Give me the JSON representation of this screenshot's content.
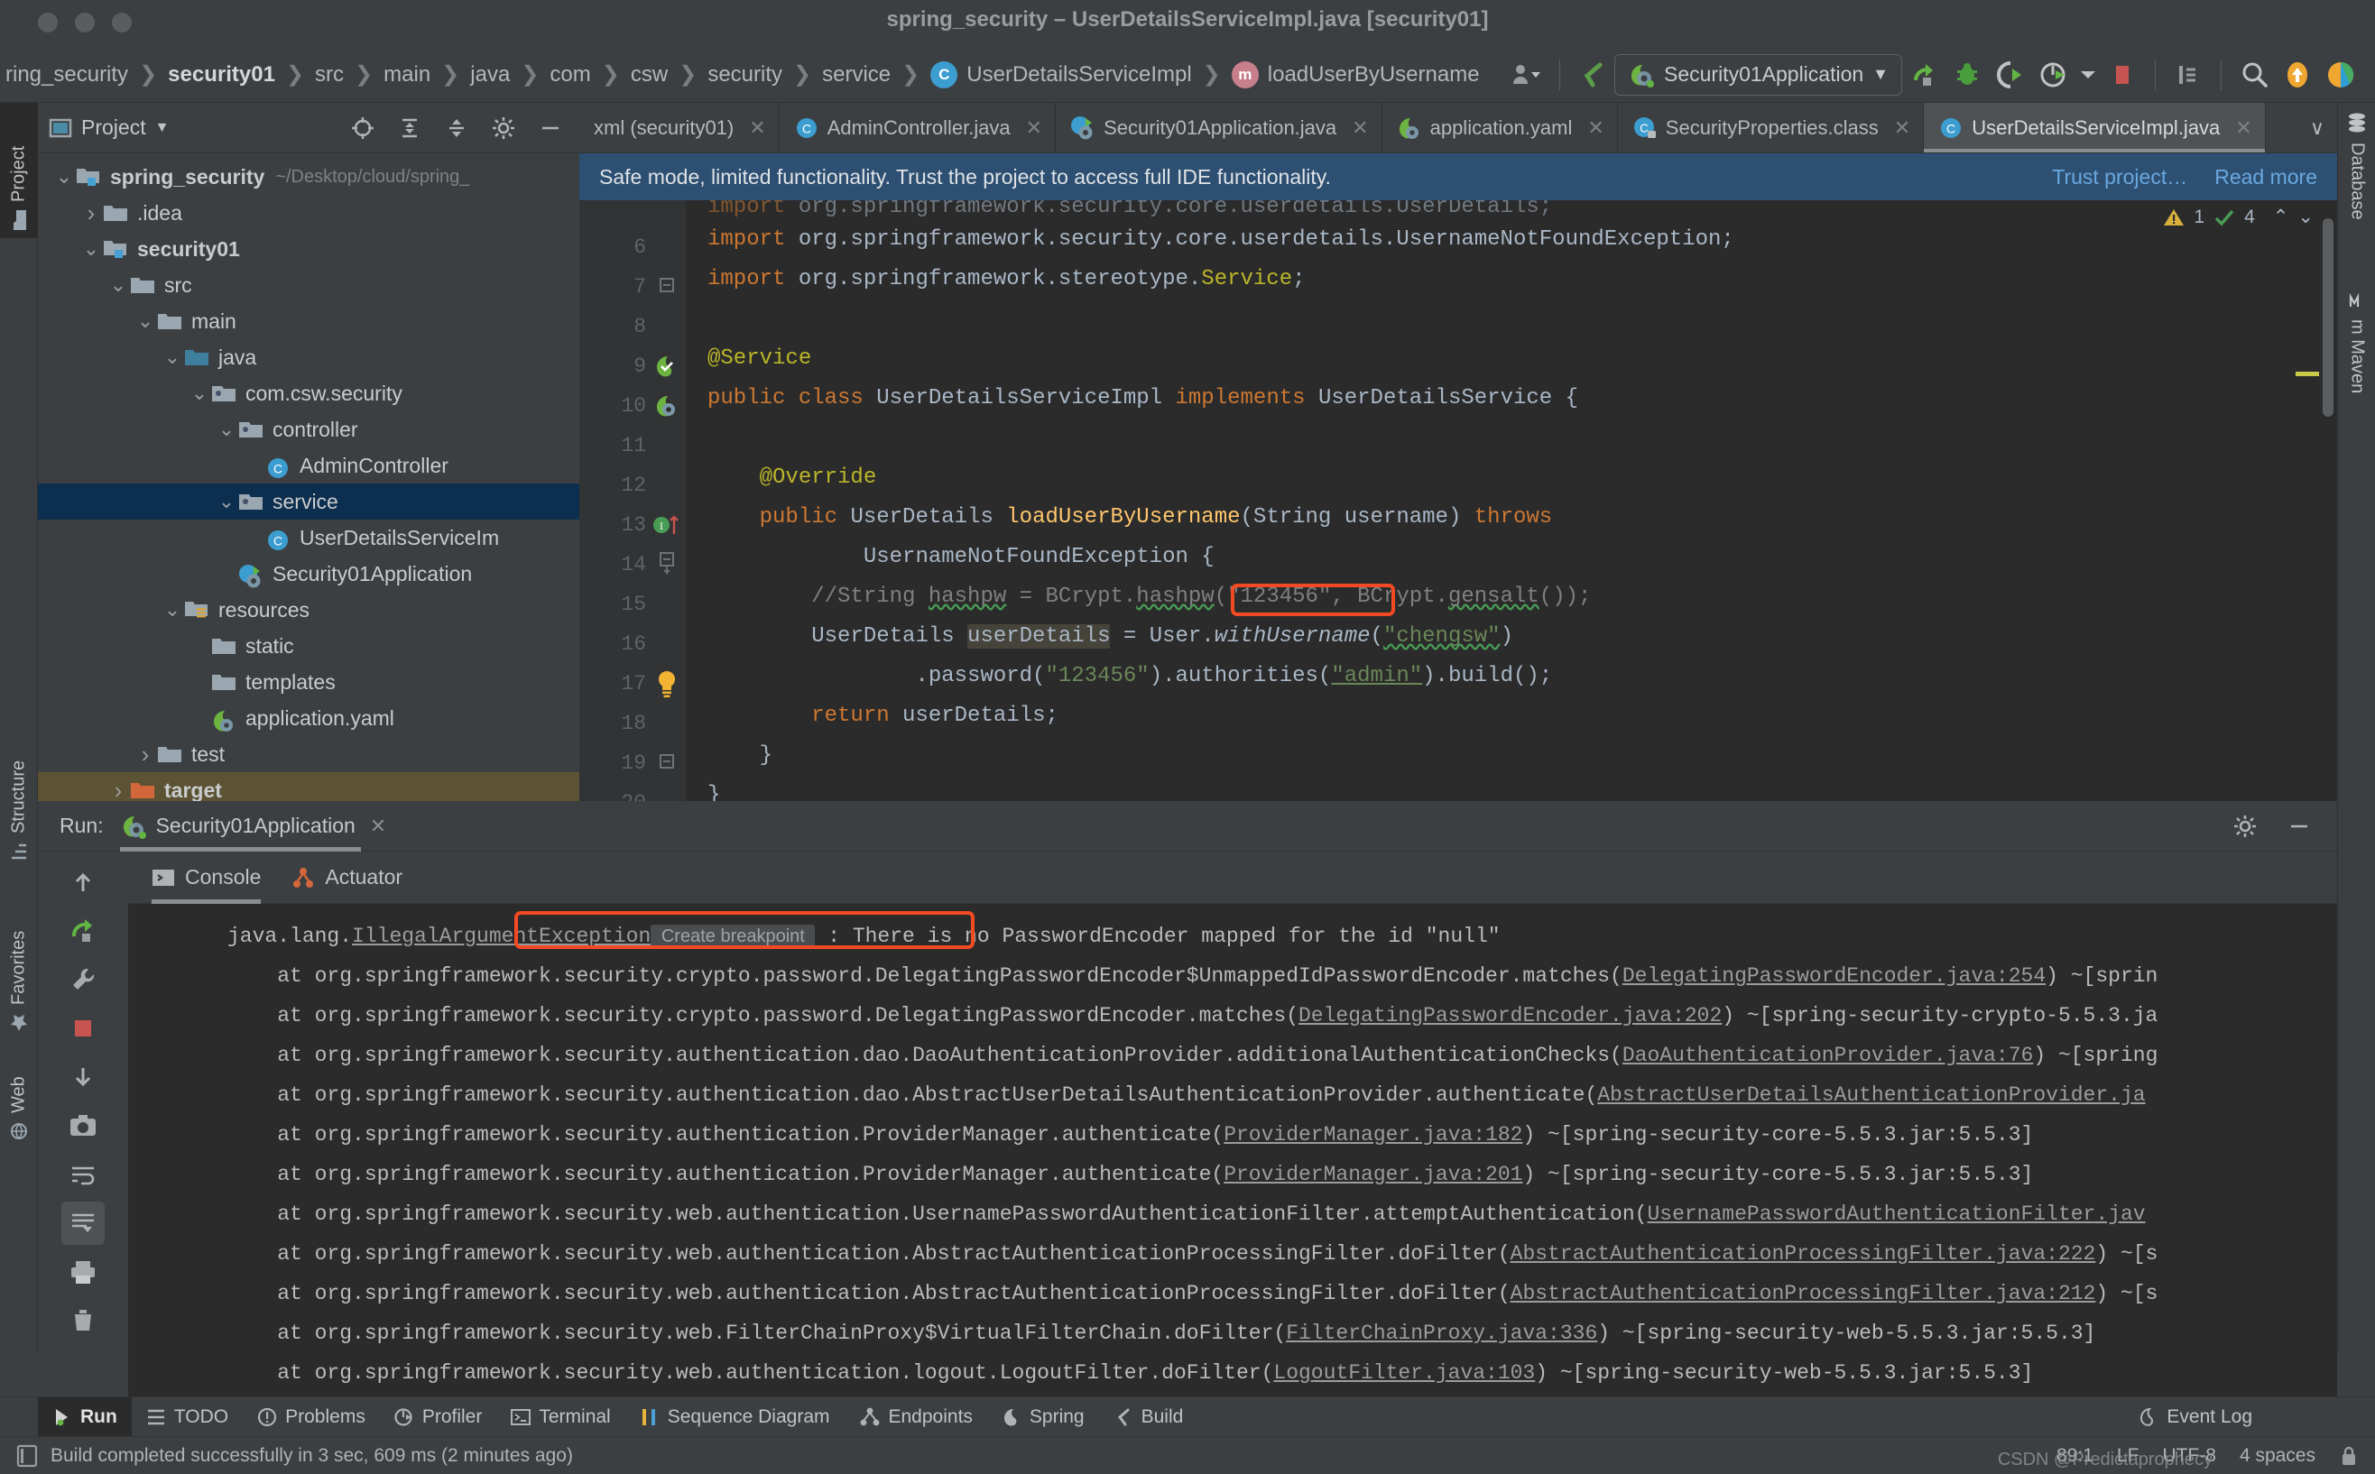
{
  "window": {
    "title": "spring_security – UserDetailsServiceImpl.java [security01]"
  },
  "breadcrumb": {
    "items": [
      {
        "label": "ring_security",
        "bold": false,
        "icon": null
      },
      {
        "label": "security01",
        "bold": true,
        "icon": null
      },
      {
        "label": "src",
        "bold": false,
        "icon": null
      },
      {
        "label": "main",
        "bold": false,
        "icon": null
      },
      {
        "label": "java",
        "bold": false,
        "icon": null
      },
      {
        "label": "com",
        "bold": false,
        "icon": null
      },
      {
        "label": "csw",
        "bold": false,
        "icon": null
      },
      {
        "label": "security",
        "bold": false,
        "icon": null
      },
      {
        "label": "service",
        "bold": false,
        "icon": null
      },
      {
        "label": "UserDetailsServiceImpl",
        "bold": false,
        "icon": "class-icon"
      },
      {
        "label": "loadUserByUsername",
        "bold": false,
        "icon": "method-icon"
      }
    ]
  },
  "toolbar": {
    "run_config_label": "Security01Application",
    "run_config_caret": "▼",
    "icons": [
      "user-dropdown-icon",
      "spring-boot-icon",
      "run-icon",
      "debug-icon",
      "run-with-coverage-icon",
      "profiler-icon",
      "stop-icon",
      "hide-sidebar-icon",
      "search-everywhere-icon",
      "update-icon",
      "ide-logo-icon"
    ]
  },
  "left_strip": {
    "items": [
      {
        "label": "Project",
        "icon": "project-folder-icon",
        "active": true
      },
      {
        "label": "Structure",
        "icon": "structure-icon",
        "active": false
      },
      {
        "label": "Favorites",
        "icon": "star-icon",
        "active": false
      },
      {
        "label": "Web",
        "icon": "web-icon",
        "active": false
      }
    ]
  },
  "right_strip": {
    "items": [
      {
        "label": "Database",
        "icon": "database-icon"
      },
      {
        "label": "m Maven",
        "icon": "maven-icon"
      }
    ]
  },
  "project_panel": {
    "title": "Project",
    "caret": "▼",
    "actions": [
      "locate-icon",
      "expand-all-icon",
      "collapse-all-icon",
      "settings-gear-icon",
      "hide-icon"
    ],
    "tree": [
      {
        "label": "spring_security",
        "path": "~/Desktop/cloud/spring_",
        "depth": 0,
        "twist": "v",
        "icon": "module-folder-icon",
        "bold": true,
        "state": "none"
      },
      {
        "label": ".idea",
        "path": "",
        "depth": 1,
        "twist": ">",
        "icon": "folder-icon",
        "bold": false,
        "state": "none"
      },
      {
        "label": "security01",
        "path": "",
        "depth": 1,
        "twist": "v",
        "icon": "module-folder-icon",
        "bold": true,
        "state": "none"
      },
      {
        "label": "src",
        "path": "",
        "depth": 2,
        "twist": "v",
        "icon": "folder-icon",
        "bold": false,
        "state": "none"
      },
      {
        "label": "main",
        "path": "",
        "depth": 3,
        "twist": "v",
        "icon": "folder-icon",
        "bold": false,
        "state": "none"
      },
      {
        "label": "java",
        "path": "",
        "depth": 4,
        "twist": "v",
        "icon": "source-folder-icon",
        "bold": false,
        "state": "none"
      },
      {
        "label": "com.csw.security",
        "path": "",
        "depth": 5,
        "twist": "v",
        "icon": "package-icon",
        "bold": false,
        "state": "none"
      },
      {
        "label": "controller",
        "path": "",
        "depth": 6,
        "twist": "v",
        "icon": "package-icon",
        "bold": false,
        "state": "none"
      },
      {
        "label": "AdminController",
        "path": "",
        "depth": 7,
        "twist": "",
        "icon": "class-icon",
        "bold": false,
        "state": "none"
      },
      {
        "label": "service",
        "path": "",
        "depth": 6,
        "twist": "v",
        "icon": "package-icon",
        "bold": false,
        "state": "selected"
      },
      {
        "label": "UserDetailsServiceIm",
        "path": "",
        "depth": 7,
        "twist": "",
        "icon": "class-icon",
        "bold": false,
        "state": "none"
      },
      {
        "label": "Security01Application",
        "path": "",
        "depth": 6,
        "twist": "",
        "icon": "spring-class-icon",
        "bold": false,
        "state": "none"
      },
      {
        "label": "resources",
        "path": "",
        "depth": 4,
        "twist": "v",
        "icon": "resources-folder-icon",
        "bold": false,
        "state": "none"
      },
      {
        "label": "static",
        "path": "",
        "depth": 5,
        "twist": "",
        "icon": "folder-icon",
        "bold": false,
        "state": "none"
      },
      {
        "label": "templates",
        "path": "",
        "depth": 5,
        "twist": "",
        "icon": "folder-icon",
        "bold": false,
        "state": "none"
      },
      {
        "label": "application.yaml",
        "path": "",
        "depth": 5,
        "twist": "",
        "icon": "spring-yaml-icon",
        "bold": false,
        "state": "none"
      },
      {
        "label": "test",
        "path": "",
        "depth": 3,
        "twist": ">",
        "icon": "folder-icon",
        "bold": false,
        "state": "none"
      },
      {
        "label": "target",
        "path": "",
        "depth": 2,
        "twist": ">",
        "icon": "target-folder-icon",
        "bold": true,
        "state": "target"
      }
    ]
  },
  "editor_tabs": {
    "tabs": [
      {
        "label": "xml (security01)",
        "icon": "",
        "active": false,
        "closable": true
      },
      {
        "label": "AdminController.java",
        "icon": "class-icon",
        "active": false,
        "closable": true
      },
      {
        "label": "Security01Application.java",
        "icon": "spring-class-icon",
        "active": false,
        "closable": true
      },
      {
        "label": "application.yaml",
        "icon": "spring-yaml-icon",
        "active": false,
        "closable": true
      },
      {
        "label": "SecurityProperties.class",
        "icon": "class-locked-icon",
        "active": false,
        "closable": true
      },
      {
        "label": "UserDetailsServiceImpl.java",
        "icon": "class-icon",
        "active": true,
        "closable": true
      }
    ],
    "overflow": "∨"
  },
  "trust_banner": {
    "message": "Safe mode, limited functionality. Trust the project to access full IDE functionality.",
    "trust_link": "Trust project…",
    "read_more_link": "Read more"
  },
  "editor": {
    "inspection": {
      "warnings": "1",
      "checks": "4",
      "up": "⌃",
      "down": "⌄"
    },
    "lines": [
      {
        "num": "",
        "gutter": "",
        "partial": true
      },
      {
        "num": "6",
        "gutter": ""
      },
      {
        "num": "7",
        "gutter": "fold-end"
      },
      {
        "num": "8",
        "gutter": ""
      },
      {
        "num": "9",
        "gutter": "spring-bean-icon"
      },
      {
        "num": "10",
        "gutter": "spring-boot-icon"
      },
      {
        "num": "11",
        "gutter": ""
      },
      {
        "num": "12",
        "gutter": ""
      },
      {
        "num": "13",
        "gutter": "implements-icon"
      },
      {
        "num": "14",
        "gutter": "fold-start"
      },
      {
        "num": "15",
        "gutter": ""
      },
      {
        "num": "16",
        "gutter": ""
      },
      {
        "num": "17",
        "gutter": "intention-bulb-icon"
      },
      {
        "num": "18",
        "gutter": ""
      },
      {
        "num": "19",
        "gutter": "fold-end"
      },
      {
        "num": "20",
        "gutter": ""
      }
    ],
    "code_text": {
      "l6": "import org.springframework.security.core.userdetails.UsernameNotFoundException;",
      "l7": "import org.springframework.stereotype.Service;",
      "l9": "@Service",
      "l10": "public class UserDetailsServiceImpl implements UserDetailsService {",
      "l12": "@Override",
      "l13": "public UserDetails loadUserByUsername(String username) throws",
      "l14": "UsernameNotFoundException {",
      "l15": "//String hashpw = BCrypt.hashpw(\"123456\", BCrypt.gensalt());",
      "l16": "UserDetails userDetails = User.withUsername(\"chengsw\")",
      "l17": ".password(\"123456\").authorities(\"admin\").build();",
      "l18": "return userDetails;",
      "l19": "}",
      "l20": "}"
    }
  },
  "run_panel": {
    "header_label": "Run:",
    "config_tab": "Security01Application",
    "config_close": "✕",
    "header_actions": [
      "settings-gear-icon",
      "minimize-icon"
    ],
    "side_actions": [
      "rerun-icon",
      "wrench-icon",
      "stop-icon",
      "down-arrow-icon",
      "up-arrow-icon",
      "camera-icon",
      "soft-wrap-icon",
      "scroll-to-end-icon",
      "print-icon",
      "clear-all-icon"
    ],
    "tabs": [
      {
        "label": "Console",
        "icon": "console-icon",
        "active": true
      },
      {
        "label": "Actuator",
        "icon": "actuator-icon",
        "active": false
      }
    ],
    "console_lines": [
      {
        "type": "exception",
        "prefix": "java.lang.",
        "exception": "IllegalArgumentException",
        "breakpoint": "Create breakpoint",
        "colon": " : ",
        "message": "There is no PasswordEncoder mapped for the id \"null\""
      },
      {
        "type": "trace",
        "text": "    at org.springframework.security.crypto.password.DelegatingPasswordEncoder$UnmappedIdPasswordEncoder.matches(",
        "link": "DelegatingPasswordEncoder.java:254",
        "tail": ") ~[sprin"
      },
      {
        "type": "trace",
        "text": "    at org.springframework.security.crypto.password.DelegatingPasswordEncoder.matches(",
        "link": "DelegatingPasswordEncoder.java:202",
        "tail": ") ~[spring-security-crypto-5.5.3.ja"
      },
      {
        "type": "trace",
        "text": "    at org.springframework.security.authentication.dao.DaoAuthenticationProvider.additionalAuthenticationChecks(",
        "link": "DaoAuthenticationProvider.java:76",
        "tail": ") ~[spring"
      },
      {
        "type": "trace",
        "text": "    at org.springframework.security.authentication.dao.AbstractUserDetailsAuthenticationProvider.authenticate(",
        "link": "AbstractUserDetailsAuthenticationProvider.ja",
        "tail": ""
      },
      {
        "type": "trace",
        "text": "    at org.springframework.security.authentication.ProviderManager.authenticate(",
        "link": "ProviderManager.java:182",
        "tail": ") ~[spring-security-core-5.5.3.jar:5.5.3]"
      },
      {
        "type": "trace",
        "text": "    at org.springframework.security.authentication.ProviderManager.authenticate(",
        "link": "ProviderManager.java:201",
        "tail": ") ~[spring-security-core-5.5.3.jar:5.5.3]"
      },
      {
        "type": "trace",
        "text": "    at org.springframework.security.web.authentication.UsernamePasswordAuthenticationFilter.attemptAuthentication(",
        "link": "UsernamePasswordAuthenticationFilter.jav",
        "tail": ""
      },
      {
        "type": "trace",
        "text": "    at org.springframework.security.web.authentication.AbstractAuthenticationProcessingFilter.doFilter(",
        "link": "AbstractAuthenticationProcessingFilter.java:222",
        "tail": ") ~[s"
      },
      {
        "type": "trace",
        "text": "    at org.springframework.security.web.authentication.AbstractAuthenticationProcessingFilter.doFilter(",
        "link": "AbstractAuthenticationProcessingFilter.java:212",
        "tail": ") ~[s"
      },
      {
        "type": "trace",
        "text": "    at org.springframework.security.web.FilterChainProxy$VirtualFilterChain.doFilter(",
        "link": "FilterChainProxy.java:336",
        "tail": ") ~[spring-security-web-5.5.3.jar:5.5.3]"
      },
      {
        "type": "trace",
        "text": "    at org.springframework.security.web.authentication.logout.LogoutFilter.doFilter(",
        "link": "LogoutFilter.java:103",
        "tail": ") ~[spring-security-web-5.5.3.jar:5.5.3]"
      }
    ]
  },
  "bottom_bar": {
    "items": [
      {
        "label": "Run",
        "icon": "run-icon",
        "active": true
      },
      {
        "label": "TODO",
        "icon": "todo-icon",
        "active": false
      },
      {
        "label": "Problems",
        "icon": "problems-icon",
        "active": false
      },
      {
        "label": "Profiler",
        "icon": "profiler-icon",
        "active": false
      },
      {
        "label": "Terminal",
        "icon": "terminal-icon",
        "active": false
      },
      {
        "label": "Sequence Diagram",
        "icon": "sequence-diagram-icon",
        "active": false
      },
      {
        "label": "Endpoints",
        "icon": "endpoints-icon",
        "active": false
      },
      {
        "label": "Spring",
        "icon": "spring-icon",
        "active": false
      },
      {
        "label": "Build",
        "icon": "build-icon",
        "active": false
      }
    ],
    "event_log": {
      "label": "Event Log",
      "icon": "event-log-icon"
    }
  },
  "status_bar": {
    "message": "Build completed successfully in 3 sec, 609 ms (2 minutes ago)",
    "caret_position": "89:1",
    "line_separator": "LF",
    "encoding": "UTF-8",
    "indent": "4 spaces",
    "watermark": "CSDN @Predictaprophecy"
  },
  "colors": {
    "accent_blue": "#3c9dd0",
    "highlight_red": "#f44a23",
    "banner_blue": "#2d4f72",
    "selection": "#0d2f4f",
    "target_row": "#5c5334",
    "editor_bg": "#2b2b2b",
    "panel_bg": "#3c3f41"
  }
}
